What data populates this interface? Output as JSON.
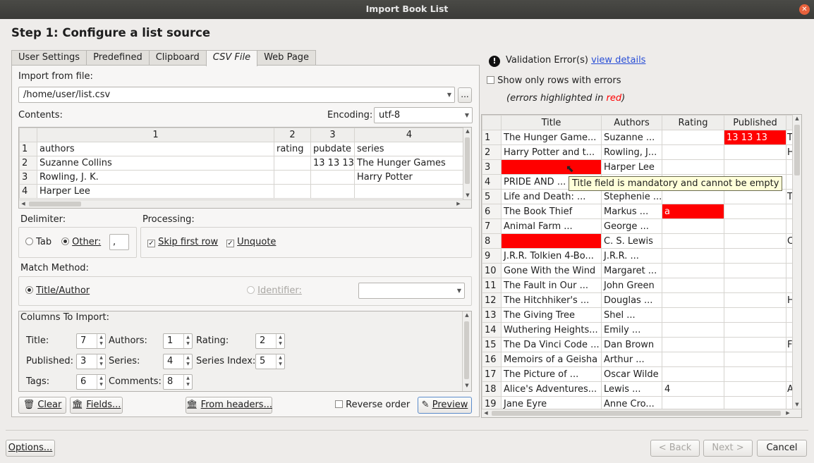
{
  "window": {
    "title": "Import Book List"
  },
  "step_title": "Step 1: Configure a list source",
  "tabs": [
    "User Settings",
    "Predefined",
    "Clipboard",
    "CSV File",
    "Web Page"
  ],
  "active_tab": "CSV File",
  "csv": {
    "import_label": "Import from file:",
    "file_path": "/home/user/list.csv",
    "browse_label": "...",
    "contents_label": "Contents:",
    "encoding_label": "Encoding:",
    "encoding_value": "utf-8",
    "contents_headers": [
      "1",
      "2",
      "3",
      "4"
    ],
    "contents_rows": [
      {
        "n": "1",
        "cells": [
          "authors",
          "rating",
          "pubdate",
          "series"
        ]
      },
      {
        "n": "2",
        "cells": [
          "Suzanne Collins",
          "",
          "13 13 13",
          "The Hunger Games"
        ]
      },
      {
        "n": "3",
        "cells": [
          "Rowling, J. K.",
          "",
          "",
          "Harry Potter"
        ]
      },
      {
        "n": "4",
        "cells": [
          "Harper Lee",
          "",
          "",
          ""
        ]
      }
    ],
    "delimiter_label": "Delimiter:",
    "tab_label": "Tab",
    "other_label": "Other:",
    "other_value": ",",
    "processing_label": "Processing:",
    "skip_first_row": "Skip first row",
    "unquote": "Unquote",
    "match_label": "Match Method:",
    "title_author": "Title/Author",
    "identifier": "Identifier:",
    "columns_label": "Columns To Import:",
    "col": {
      "title_label": "Title:",
      "title": "7",
      "authors_label": "Authors:",
      "authors": "1",
      "rating_label": "Rating:",
      "rating": "2",
      "published_label": "Published:",
      "published": "3",
      "series_label": "Series:",
      "series": "4",
      "series_index_label": "Series Index:",
      "series_index": "5",
      "tags_label": "Tags:",
      "tags": "6",
      "comments_label": "Comments:",
      "comments": "8"
    },
    "clear_btn": "Clear",
    "fields_btn": "Fields...",
    "from_headers_btn": "From headers...",
    "reverse_order": "Reverse order",
    "preview_btn": "Preview"
  },
  "validation": {
    "message": "Validation Error(s)",
    "link": "view details",
    "show_only_errors": "Show only rows with errors",
    "note_prefix": "(errors highlighted in ",
    "note_red": "red",
    "note_suffix": ")"
  },
  "preview": {
    "headers": [
      "Title",
      "Authors",
      "Rating",
      "Published"
    ],
    "rows": [
      {
        "n": "1",
        "title": "The Hunger Game...",
        "authors": "Suzanne ...",
        "rating": "",
        "published": "13 13 13",
        "extra": "T",
        "err": [
          "published"
        ]
      },
      {
        "n": "2",
        "title": "Harry Potter and t...",
        "authors": "Rowling, J...",
        "rating": "",
        "published": "",
        "extra": "H",
        "err": []
      },
      {
        "n": "3",
        "title": "",
        "authors": "Harper Lee",
        "rating": "",
        "published": "",
        "extra": "",
        "err": [
          "title"
        ]
      },
      {
        "n": "4",
        "title": "PRIDE AND ...",
        "authors": "",
        "rating": "",
        "published": "",
        "extra": "",
        "err": []
      },
      {
        "n": "5",
        "title": "Life and Death: ...",
        "authors": "Stephenie ...",
        "rating": "",
        "published": "",
        "extra": "T",
        "err": []
      },
      {
        "n": "6",
        "title": "The Book Thief",
        "authors": "Markus ...",
        "rating": "a",
        "published": "",
        "extra": "",
        "err": [
          "rating"
        ]
      },
      {
        "n": "7",
        "title": "Animal Farm ...",
        "authors": "George ...",
        "rating": "",
        "published": "",
        "extra": "",
        "err": []
      },
      {
        "n": "8",
        "title": "",
        "authors": "C. S. Lewis",
        "rating": "",
        "published": "",
        "extra": "C",
        "err": [
          "title"
        ]
      },
      {
        "n": "9",
        "title": "J.R.R. Tolkien 4-Bo...",
        "authors": "J.R.R. ...",
        "rating": "",
        "published": "",
        "extra": "",
        "err": []
      },
      {
        "n": "10",
        "title": "Gone With the Wind",
        "authors": "Margaret ...",
        "rating": "",
        "published": "",
        "extra": "",
        "err": []
      },
      {
        "n": "11",
        "title": "The Fault in Our ...",
        "authors": "John Green",
        "rating": "",
        "published": "",
        "extra": "",
        "err": []
      },
      {
        "n": "12",
        "title": "The Hitchhiker's ...",
        "authors": "Douglas ...",
        "rating": "",
        "published": "",
        "extra": "H",
        "err": []
      },
      {
        "n": "13",
        "title": "The Giving Tree",
        "authors": "Shel ...",
        "rating": "",
        "published": "",
        "extra": "",
        "err": []
      },
      {
        "n": "14",
        "title": "Wuthering Heights...",
        "authors": "Emily ...",
        "rating": "",
        "published": "",
        "extra": "",
        "err": []
      },
      {
        "n": "15",
        "title": "The Da Vinci Code ...",
        "authors": "Dan Brown",
        "rating": "",
        "published": "",
        "extra": "F",
        "err": []
      },
      {
        "n": "16",
        "title": "Memoirs of a Geisha",
        "authors": "Arthur ...",
        "rating": "",
        "published": "",
        "extra": "",
        "err": []
      },
      {
        "n": "17",
        "title": "The Picture of ...",
        "authors": "Oscar Wilde",
        "rating": "",
        "published": "",
        "extra": "",
        "err": []
      },
      {
        "n": "18",
        "title": "Alice's Adventures...",
        "authors": "Lewis ...",
        "rating": "4",
        "published": "",
        "extra": "A",
        "err": []
      },
      {
        "n": "19",
        "title": "Jane Eyre",
        "authors": "Anne Cro...",
        "rating": "",
        "published": "",
        "extra": "",
        "err": []
      }
    ],
    "tooltip": "Title field is mandatory and cannot be empty"
  },
  "footer": {
    "options": "Options...",
    "back": "< Back",
    "next": "Next >",
    "cancel": "Cancel"
  },
  "colors": {
    "error": "#ff0000",
    "link": "#2a4fd6",
    "titlebar": "#3d3d3a",
    "close": "#e8613b"
  }
}
